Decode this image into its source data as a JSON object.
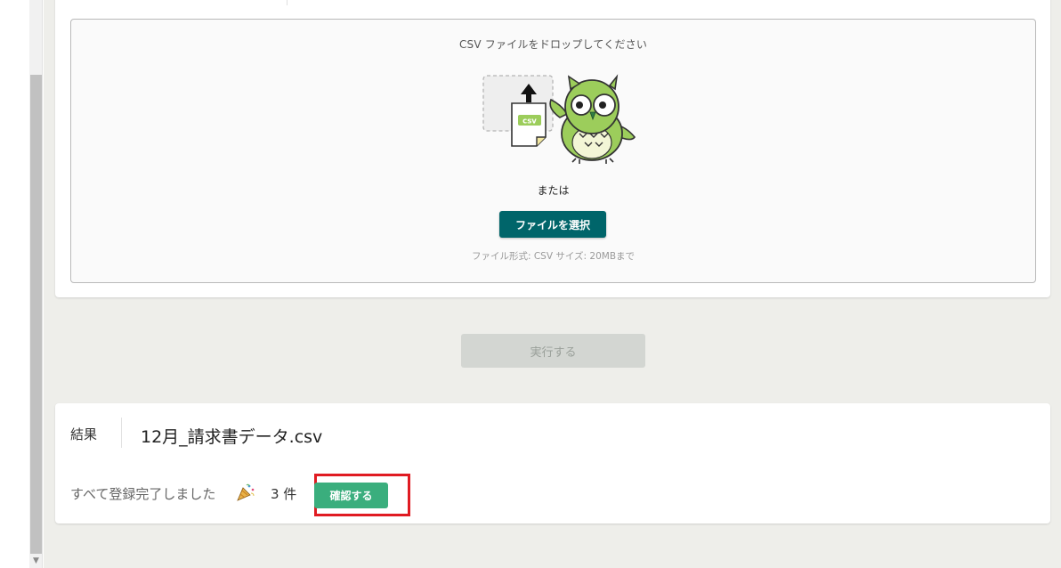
{
  "upload": {
    "drop_prompt": "CSV ファイルをドロップしてください",
    "csv_tag": "csv",
    "or_text": "または",
    "select_file_label": "ファイルを選択",
    "format_note": "ファイル形式: CSV サイズ: 20MBまで"
  },
  "run": {
    "label": "実行する"
  },
  "result": {
    "label": "結果",
    "filename": "12月_請求書データ.csv",
    "message": "すべて登録完了しました",
    "count": "3 件",
    "confirm_label": "確認する"
  },
  "colors": {
    "page_bg": "#eeeeea",
    "select_button": "#00656a",
    "confirm_button": "#3aae7d",
    "run_button_disabled": "#d3d6d2",
    "highlight": "#e01b22"
  },
  "icons": [
    "upload-arrow-icon",
    "csv-file-icon",
    "owl-mascot",
    "party-popper-icon",
    "scroll-down-arrow-icon"
  ]
}
